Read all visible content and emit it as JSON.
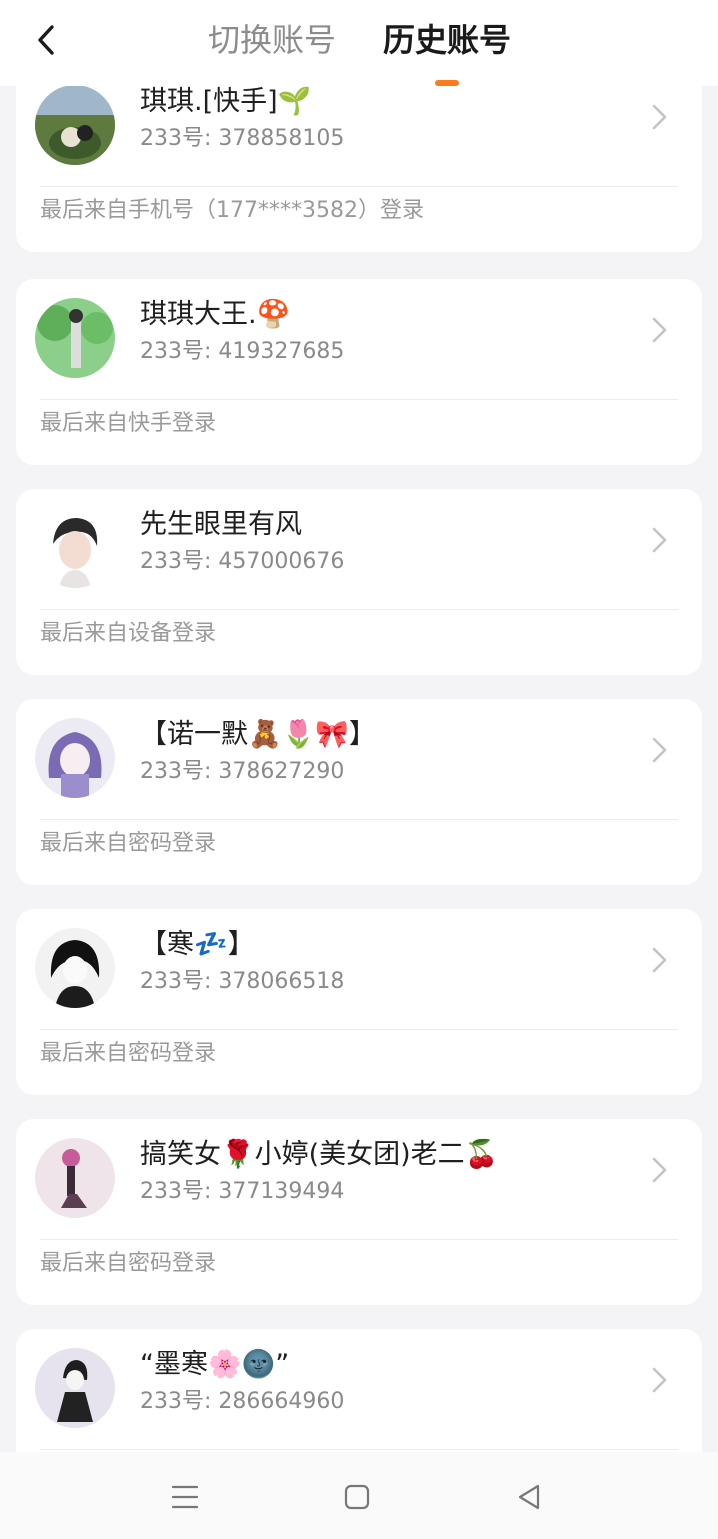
{
  "header": {
    "tabs": [
      {
        "label": "切换账号",
        "active": false
      },
      {
        "label": "历史账号",
        "active": true
      }
    ],
    "back_icon": "chevron-left-icon",
    "accent_color": "#ff7a1a"
  },
  "accounts": [
    {
      "nickname": "琪琪.[快手]🌱",
      "uid": "233号: 378858105",
      "login_source": "最后来自手机号（177****3582）登录"
    },
    {
      "nickname": "琪琪大王.🍄",
      "uid": "233号: 419327685",
      "login_source": "最后来自快手登录"
    },
    {
      "nickname": "先生眼里有风",
      "uid": "233号: 457000676",
      "login_source": "最后来自设备登录"
    },
    {
      "nickname": "【诺一默🧸🌷🎀】",
      "uid": "233号: 378627290",
      "login_source": "最后来自密码登录"
    },
    {
      "nickname": "【寒💤】",
      "uid": "233号: 378066518",
      "login_source": "最后来自密码登录"
    },
    {
      "nickname": "搞笑女🌹小婷(美女团)老二🍒",
      "uid": "233号: 377139494",
      "login_source": "最后来自密码登录"
    },
    {
      "nickname": "“墨寒🌸🌚”",
      "uid": "233号: 286664960",
      "login_source": ""
    }
  ],
  "navbar": {
    "icons": [
      "menu-icon",
      "home-square-icon",
      "back-triangle-icon"
    ]
  }
}
